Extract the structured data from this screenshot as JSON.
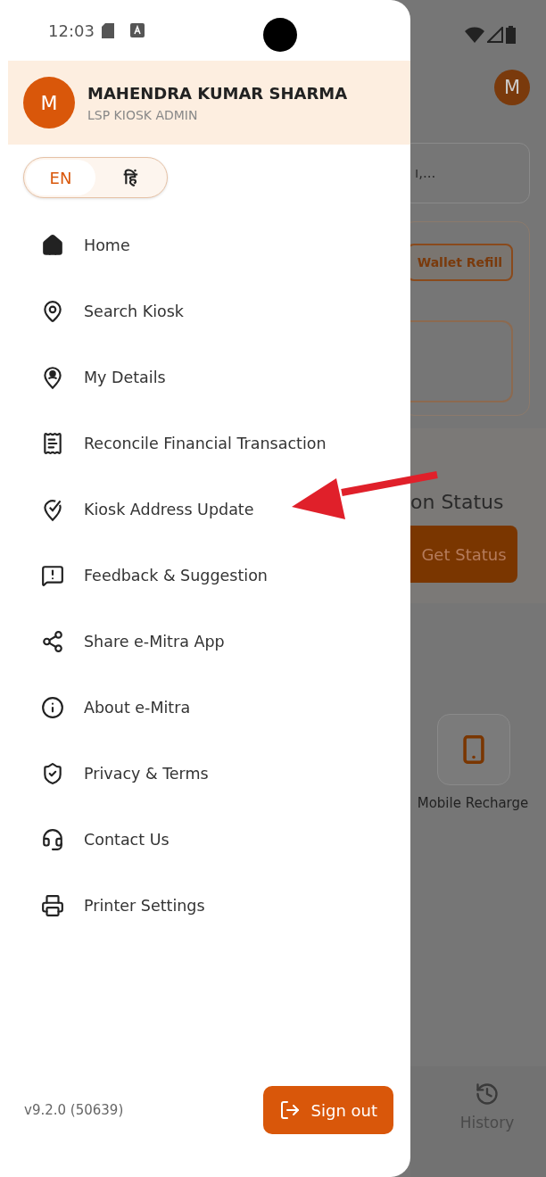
{
  "status_bar": {
    "time": "12:03"
  },
  "profile": {
    "avatar_letter": "M",
    "name": "MAHENDRA KUMAR SHARMA",
    "role": "LSP KIOSK ADMIN"
  },
  "language_toggle": [
    {
      "label": "EN",
      "selected": true
    },
    {
      "label": "हिं",
      "selected": false
    }
  ],
  "menu": [
    {
      "label": "Home",
      "kind": "home"
    },
    {
      "label": "Search Kiosk",
      "kind": "pin"
    },
    {
      "label": "My Details",
      "kind": "person"
    },
    {
      "label": "Reconcile Financial Transaction",
      "kind": "receipt"
    },
    {
      "label": "Kiosk Address Update",
      "kind": "address"
    },
    {
      "label": "Feedback & Suggestion",
      "kind": "feedback"
    },
    {
      "label": "Share e-Mitra App",
      "kind": "share"
    },
    {
      "label": "About e-Mitra",
      "kind": "info"
    },
    {
      "label": "Privacy & Terms",
      "kind": "privacy"
    },
    {
      "label": "Contact Us",
      "kind": "contact"
    },
    {
      "label": "Printer Settings",
      "kind": "printer"
    }
  ],
  "footer": {
    "version": "v9.2.0 (50639)",
    "sign_out": "Sign out"
  },
  "background_screen": {
    "avatar_letter": "M",
    "search_text": "ı,...",
    "wallet_button": "Wallet Refill",
    "section_title": "on Status",
    "status_button": "Get Status",
    "tiles": [
      {
        "label": "Mobile Recharge"
      }
    ],
    "nav": [
      {
        "label": "History"
      }
    ]
  }
}
